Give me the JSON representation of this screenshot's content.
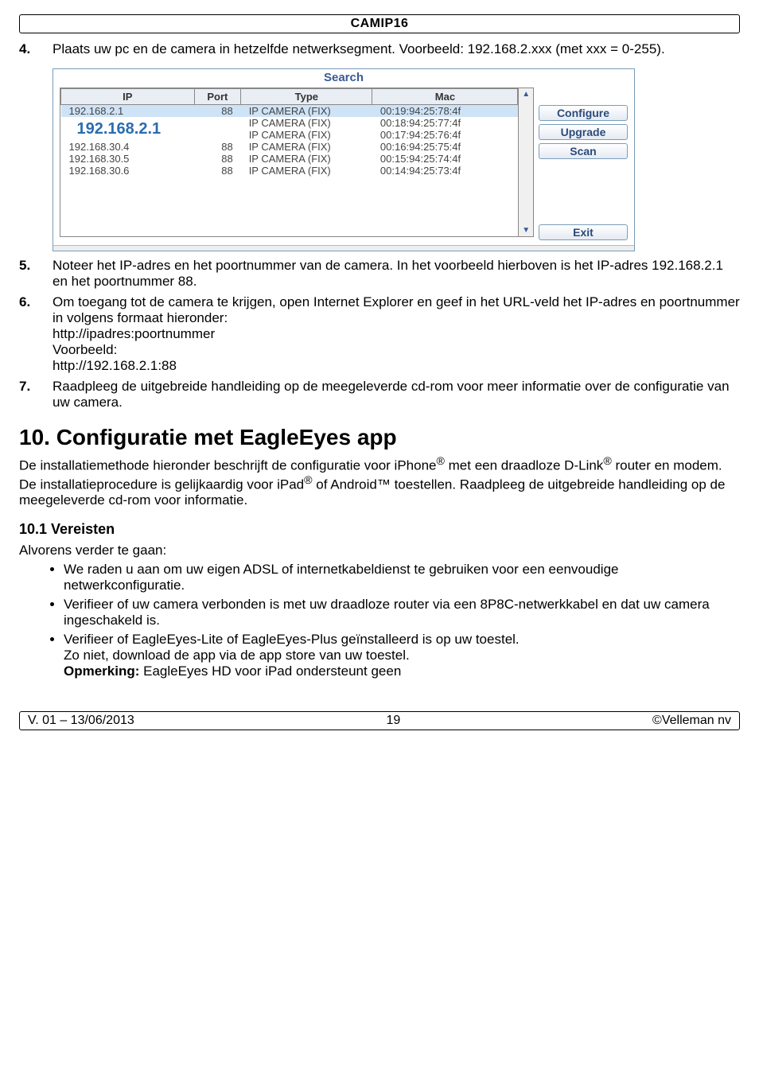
{
  "header": {
    "title": "CAMIP16"
  },
  "steps": {
    "s4": {
      "num": "4.",
      "text": "Plaats uw pc en de camera in hetzelfde netwerksegment. Voorbeeld: 192.168.2.xxx (met xxx = 0-255)."
    },
    "s5": {
      "num": "5.",
      "text": "Noteer het IP-adres en het poortnummer van de camera. In het voorbeeld hierboven is het IP-adres 192.168.2.1 en het poortnummer 88."
    },
    "s6": {
      "num": "6.",
      "text": "Om toegang tot de camera te krijgen, open Internet Explorer en geef in het URL-veld het IP-adres en poortnummer in volgens formaat hieronder:",
      "line1": "http://ipadres:poortnummer",
      "line2": "Voorbeeld:",
      "line3": "http://192.168.2.1:88"
    },
    "s7": {
      "num": "7.",
      "text": "Raadpleeg de uitgebreide handleiding op de meegeleverde cd-rom voor meer informatie over de configuratie van uw camera."
    }
  },
  "search": {
    "title": "Search",
    "headers": {
      "ip": "IP",
      "port": "Port",
      "type": "Type",
      "mac": "Mac"
    },
    "big_ip": "192.168.2.1",
    "rows": [
      {
        "ip": "192.168.2.1",
        "port": "88",
        "type": "IP CAMERA (FIX)",
        "mac": "00:19:94:25:78:4f",
        "selected": true
      },
      {
        "ip": "",
        "port": "",
        "type": "IP CAMERA (FIX)",
        "mac": "00:18:94:25:77:4f"
      },
      {
        "ip": "",
        "port": "",
        "type": "IP CAMERA (FIX)",
        "mac": "00:17:94:25:76:4f"
      },
      {
        "ip": "192.168.30.4",
        "port": "88",
        "type": "IP CAMERA (FIX)",
        "mac": "00:16:94:25:75:4f",
        "dim": true
      },
      {
        "ip": "192.168.30.5",
        "port": "88",
        "type": "IP CAMERA (FIX)",
        "mac": "00:15:94:25:74:4f"
      },
      {
        "ip": "192.168.30.6",
        "port": "88",
        "type": "IP CAMERA (FIX)",
        "mac": "00:14:94:25:73:4f"
      }
    ],
    "buttons": {
      "configure": "Configure",
      "upgrade": "Upgrade",
      "scan": "Scan",
      "exit": "Exit"
    }
  },
  "section10": {
    "heading": "10.  Configuratie met EagleEyes app",
    "intro_a": "De installatiemethode hieronder beschrijft de configuratie voor iPhone",
    "intro_b": " met een draadloze D-Link",
    "intro_c": " router en modem. De installatieprocedure is gelijkaardig voor iPad",
    "intro_d": " of Android™ toestellen. Raadpleeg de uitgebreide handleiding op de meegeleverde cd-rom voor informatie.",
    "sub_heading": "10.1  Vereisten",
    "sub_text": "Alvorens verder te gaan:",
    "bullets": {
      "b1": "We raden u aan om uw eigen ADSL of internetkabeldienst te gebruiken voor een eenvoudige netwerkconfiguratie.",
      "b2": "Verifieer of uw camera verbonden is met uw draadloze router via een 8P8C-netwerkkabel en dat uw camera ingeschakeld is.",
      "b3_a": "Verifieer of EagleEyes-Lite of EagleEyes-Plus geïnstalleerd is op uw toestel.",
      "b3_b": "Zo niet, download de app via de app store van uw toestel.",
      "b3_c_prefix": "Opmerking:",
      "b3_c": " EagleEyes HD voor iPad ondersteunt geen"
    }
  },
  "footer": {
    "left": "V. 01 – 13/06/2013",
    "center": "19",
    "right": "©Velleman nv"
  }
}
